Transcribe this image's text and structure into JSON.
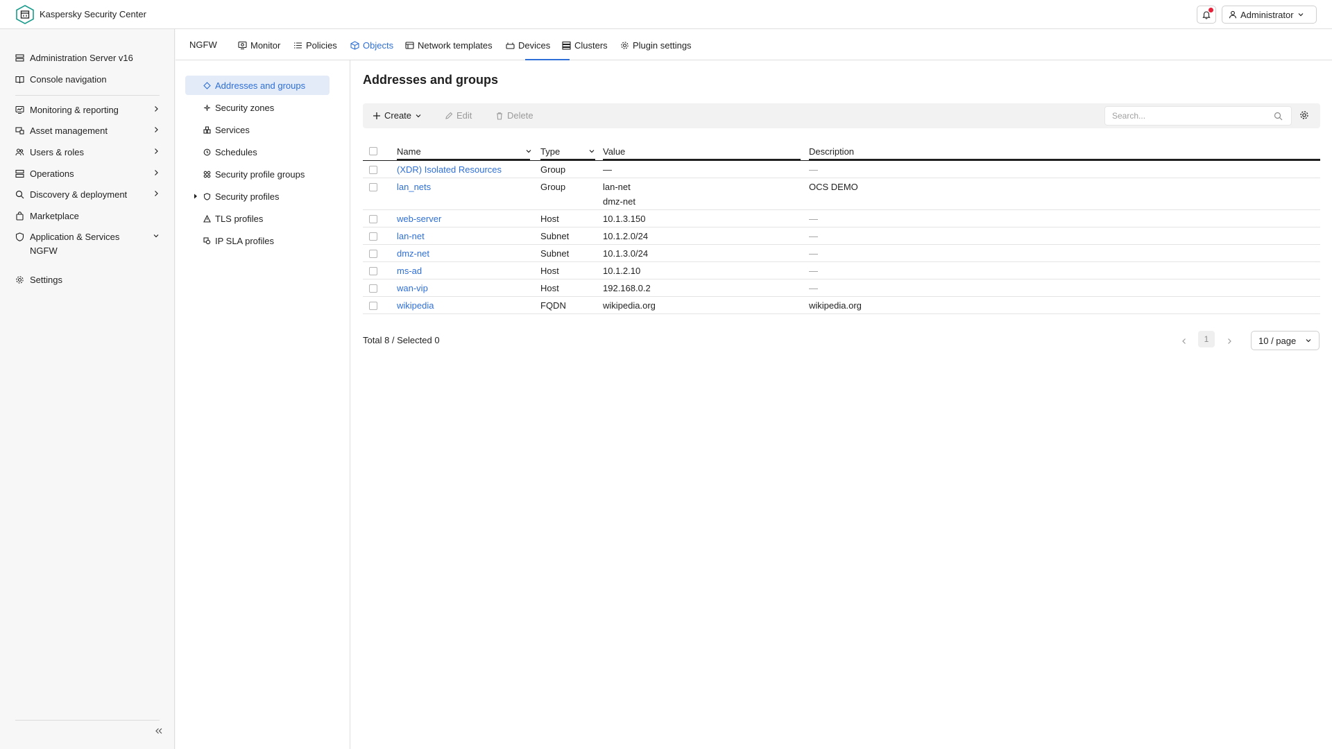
{
  "app": {
    "title": "Kaspersky Security Center",
    "user": "Administrator"
  },
  "sidebar": {
    "items": [
      {
        "label": "Administration Server v16",
        "icon": "server-icon"
      },
      {
        "label": "Console navigation",
        "icon": "book-icon"
      },
      {
        "label": "Monitoring & reporting",
        "icon": "monitor-icon"
      },
      {
        "label": "Asset management",
        "icon": "asset-icon"
      },
      {
        "label": "Users & roles",
        "icon": "users-icon"
      },
      {
        "label": "Operations",
        "icon": "operations-icon"
      },
      {
        "label": "Discovery & deployment",
        "icon": "search-icon"
      },
      {
        "label": "Marketplace",
        "icon": "bag-icon"
      },
      {
        "label": "Application & Services",
        "icon": "shield-icon"
      },
      {
        "label": "Settings",
        "icon": "gear-icon"
      }
    ],
    "sub_items": [
      "NGFW"
    ]
  },
  "tabs": {
    "section": "NGFW",
    "items": [
      "Monitor",
      "Policies",
      "Objects",
      "Network templates",
      "Devices",
      "Clusters",
      "Plugin settings"
    ],
    "active": "Objects"
  },
  "subnav": {
    "items": [
      "Addresses and groups",
      "Security zones",
      "Services",
      "Schedules",
      "Security profile groups",
      "Security profiles",
      "TLS profiles",
      "IP SLA profiles"
    ],
    "active": "Addresses and groups"
  },
  "main": {
    "title": "Addresses and groups",
    "toolbar": {
      "create": "Create",
      "edit": "Edit",
      "delete": "Delete",
      "search_placeholder": "Search..."
    },
    "columns": [
      "Name",
      "Type",
      "Value",
      "Description"
    ],
    "rows": [
      {
        "name": "(XDR) Isolated Resources",
        "type": "Group",
        "value": [
          "—"
        ],
        "description": "—"
      },
      {
        "name": "lan_nets",
        "type": "Group",
        "value": [
          "lan-net",
          "dmz-net"
        ],
        "description": "OCS DEMO"
      },
      {
        "name": "web-server",
        "type": "Host",
        "value": [
          "10.1.3.150"
        ],
        "description": "—"
      },
      {
        "name": "lan-net",
        "type": "Subnet",
        "value": [
          "10.1.2.0/24"
        ],
        "description": "—"
      },
      {
        "name": "dmz-net",
        "type": "Subnet",
        "value": [
          "10.1.3.0/24"
        ],
        "description": "—"
      },
      {
        "name": "ms-ad",
        "type": "Host",
        "value": [
          "10.1.2.10"
        ],
        "description": "—"
      },
      {
        "name": "wan-vip",
        "type": "Host",
        "value": [
          "192.168.0.2"
        ],
        "description": "—"
      },
      {
        "name": "wikipedia",
        "type": "FQDN",
        "value": [
          "wikipedia.org"
        ],
        "description": "wikipedia.org"
      }
    ],
    "footer": {
      "total": "Total 8 / Selected 0",
      "page": "1",
      "per_page": "10 / page"
    }
  },
  "colors": {
    "accent": "#2e6fd7",
    "active_bg": "#e3ebf8",
    "badge": "#e8213a"
  }
}
